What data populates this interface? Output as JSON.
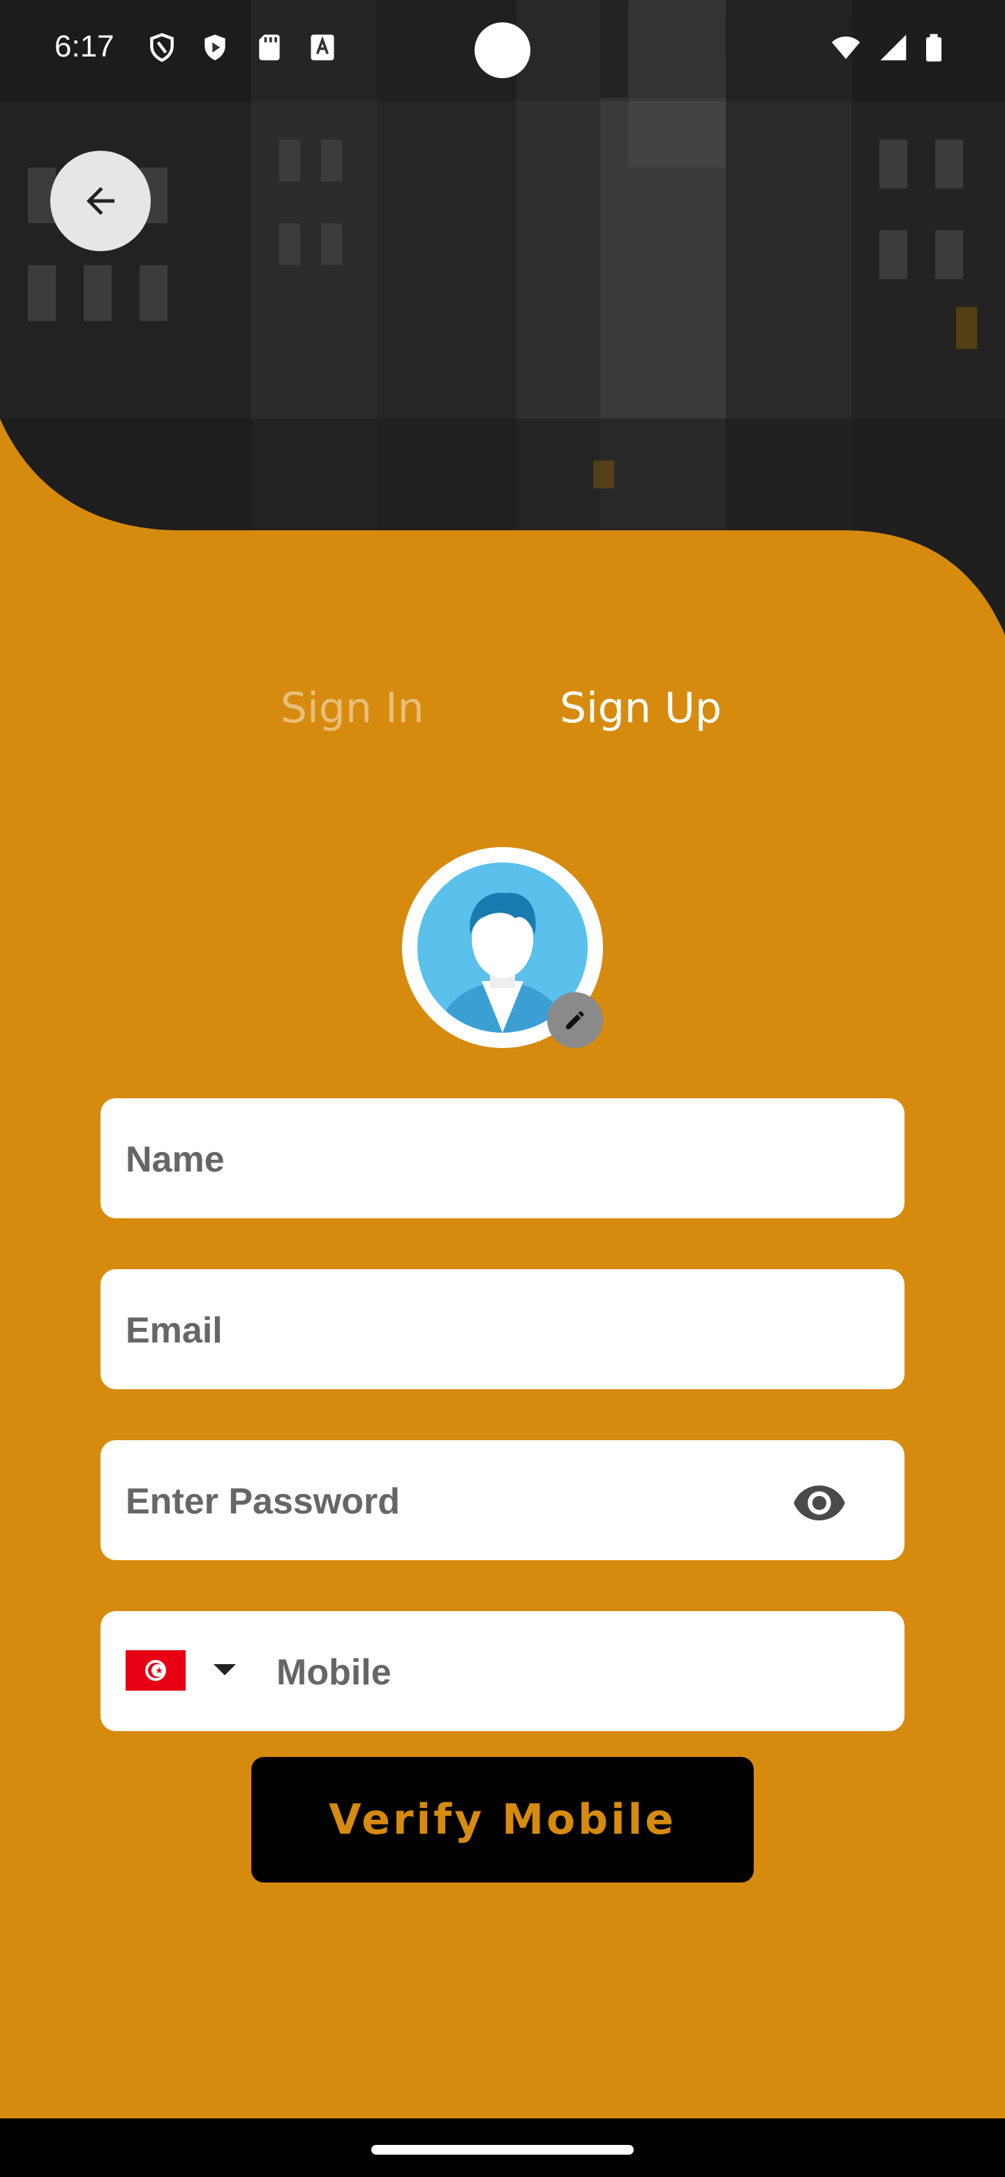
{
  "status_bar": {
    "time": "6:17",
    "icons": [
      "shield-icon",
      "play-protect-icon",
      "sd-card-icon",
      "a-badge-icon",
      "wifi-icon",
      "signal-icon",
      "battery-icon"
    ]
  },
  "header": {
    "back_icon": "arrow-left-icon"
  },
  "tabs": [
    {
      "label": "Sign In",
      "active": false
    },
    {
      "label": "Sign Up",
      "active": true
    }
  ],
  "avatar": {
    "icon": "default-avatar-icon",
    "edit_icon": "pencil-icon"
  },
  "form": {
    "name_placeholder": "Name",
    "email_placeholder": "Email",
    "password_placeholder": "Enter Password",
    "mobile_placeholder": "Mobile",
    "country_flag": "tunisia-flag-icon",
    "password_toggle_icon": "eye-icon"
  },
  "actions": {
    "verify_label": "Verify Mobile"
  },
  "colors": {
    "accent": "#D68B0E",
    "button_bg": "#000000",
    "field_bg": "#FFFFFF"
  }
}
